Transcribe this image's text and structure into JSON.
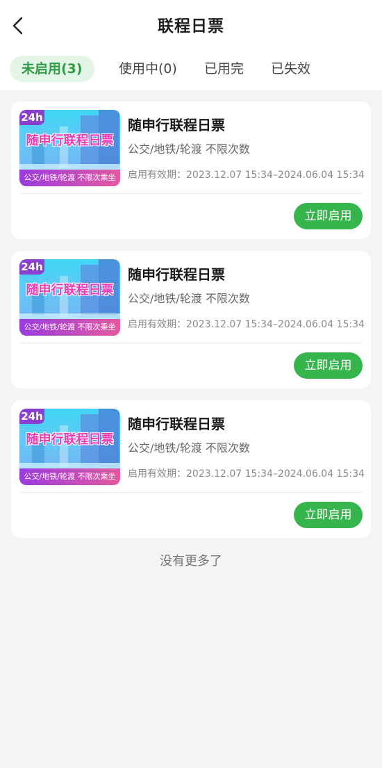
{
  "header": {
    "title": "联程日票"
  },
  "tabs": [
    {
      "label": "未启用(3)",
      "active": true
    },
    {
      "label": "使用中(0)",
      "active": false
    },
    {
      "label": "已用完",
      "active": false
    },
    {
      "label": "已失效",
      "active": false
    }
  ],
  "tickets": [
    {
      "thumb_badge": "24h",
      "thumb_title": "随申行联程日票",
      "thumb_banner": "公交/地铁/轮渡 不限次乘坐",
      "name": "随申行联程日票",
      "desc": "公交/地铁/轮渡 不限次数",
      "validity": "启用有效期：2023.12.07 15:34–2024.06.04 15:34",
      "action": "立即启用"
    },
    {
      "thumb_badge": "24h",
      "thumb_title": "随申行联程日票",
      "thumb_banner": "公交/地铁/轮渡 不限次乘坐",
      "name": "随申行联程日票",
      "desc": "公交/地铁/轮渡 不限次数",
      "validity": "启用有效期：2023.12.07 15:34–2024.06.04 15:34",
      "action": "立即启用"
    },
    {
      "thumb_badge": "24h",
      "thumb_title": "随申行联程日票",
      "thumb_banner": "公交/地铁/轮渡 不限次乘坐",
      "name": "随申行联程日票",
      "desc": "公交/地铁/轮渡 不限次数",
      "validity": "启用有效期：2023.12.07 15:34–2024.06.04 15:34",
      "action": "立即启用"
    }
  ],
  "footer": {
    "no_more": "没有更多了"
  },
  "colors": {
    "accent": "#35b54b",
    "tab_active_bg": "#e3f5e6",
    "tab_active_text": "#2f9b46"
  },
  "icons": {
    "back": "chevron-left-icon"
  }
}
